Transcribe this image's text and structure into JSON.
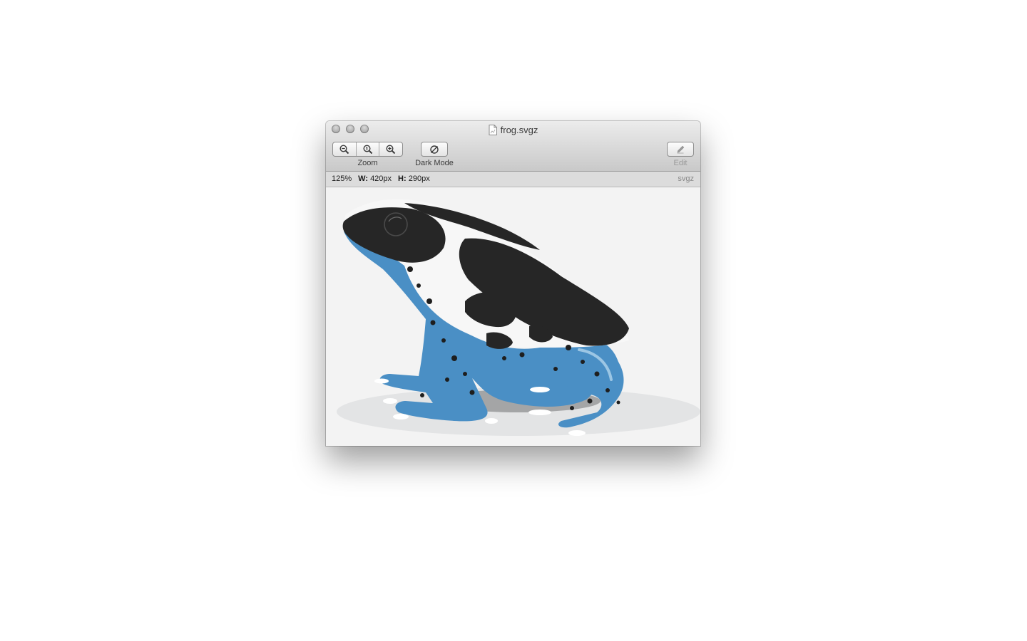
{
  "window": {
    "title": "frog.svgz"
  },
  "toolbar": {
    "zoom_label": "Zoom",
    "dark_mode_label": "Dark Mode",
    "edit_label": "Edit"
  },
  "info": {
    "zoom": "125%",
    "width_key": "W:",
    "width_value": "420px",
    "height_key": "H:",
    "height_value": "290px",
    "format": "svgz"
  },
  "colors": {
    "frog_blue": "#4a8fc5",
    "frog_black": "#262626",
    "canvas_bg": "#f3f3f3"
  }
}
